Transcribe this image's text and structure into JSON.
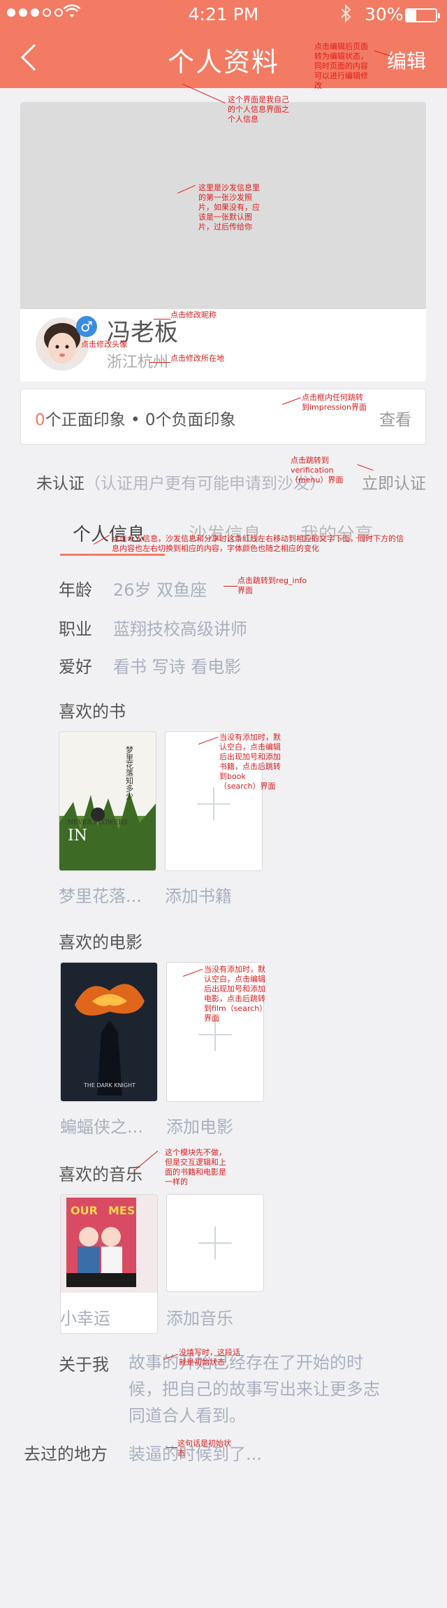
{
  "status_bar": {
    "time": "4:21 PM",
    "battery": "30%"
  },
  "nav": {
    "title": "个人资料",
    "edit": "编辑"
  },
  "profile": {
    "nickname": "冯老板",
    "location": "浙江杭州",
    "gender_symbol": "♂"
  },
  "impressions": {
    "zero": "0",
    "text": "个正面印象 • 0个负面印象",
    "view": "查看"
  },
  "verification": {
    "status": "未认证",
    "hint": "（认证用户更有可能申请到沙发）",
    "action": "立即认证"
  },
  "tabs": [
    "个人信息",
    "沙发信息",
    "我的分享"
  ],
  "info": [
    {
      "label": "年龄",
      "value": "26岁   双鱼座"
    },
    {
      "label": "职业",
      "value": "蓝翔技校高级讲师"
    },
    {
      "label": "爱好",
      "value": "看书  写诗  看电影"
    }
  ],
  "books": {
    "title": "喜欢的书",
    "item": "梦里花落...",
    "add": "添加书籍"
  },
  "movies": {
    "title": "喜欢的电影",
    "item": "蝙蝠侠之...",
    "add": "添加电影"
  },
  "music": {
    "title": "喜欢的音乐",
    "item": "小幸运",
    "add": "添加音乐"
  },
  "about": {
    "label": "关于我",
    "text": "故事的开始已经存在了开始的时候，把自己的故事写出来让更多志同道合人看到。"
  },
  "visited": {
    "label": "去过的地方",
    "text": "装逼的时候到了..."
  },
  "annotations": {
    "edit": "点击编辑后页面转为编辑状态，同时页面的内容可以进行编辑修改",
    "title": "这个界面是我自己的个人信息界面之个人信息",
    "cover": "这里是沙发信息里的第一张沙发照片，如果没有，应该是一张默认图片，过后传给你",
    "nickname": "点击修改昵称",
    "avatar": "点击修改头像",
    "location": "点击修改所在地",
    "impress": "点击框内任何跳转到impression界面",
    "verify": "点击跳转到verification（menu）界面",
    "tabs": "点击个人信息，沙发信息和分享时这条红线左右移动到相应的文字下面，同时下方的信息内容也左右切换到相应的内容，字体颜色也随之相应的变化",
    "reg": "点击跳转到reg_info 界面",
    "book_add": "当没有添加时，默认空白，点击编辑后出现加号和添加书籍，点击后跳转到book（search）界面",
    "movie_add": "当没有添加时，默认空白，点击编辑后出现加号和添加电影，点击后跳转到film（search）界面",
    "music": "这个模块先不做，但是交互逻辑和上面的书籍和电影是一样的",
    "about": "没填写时，这段话就是初始状态",
    "visited": "这句话是初始状态"
  },
  "colors": {
    "brand": "#f37b63",
    "annotation": "#e21b1b"
  }
}
